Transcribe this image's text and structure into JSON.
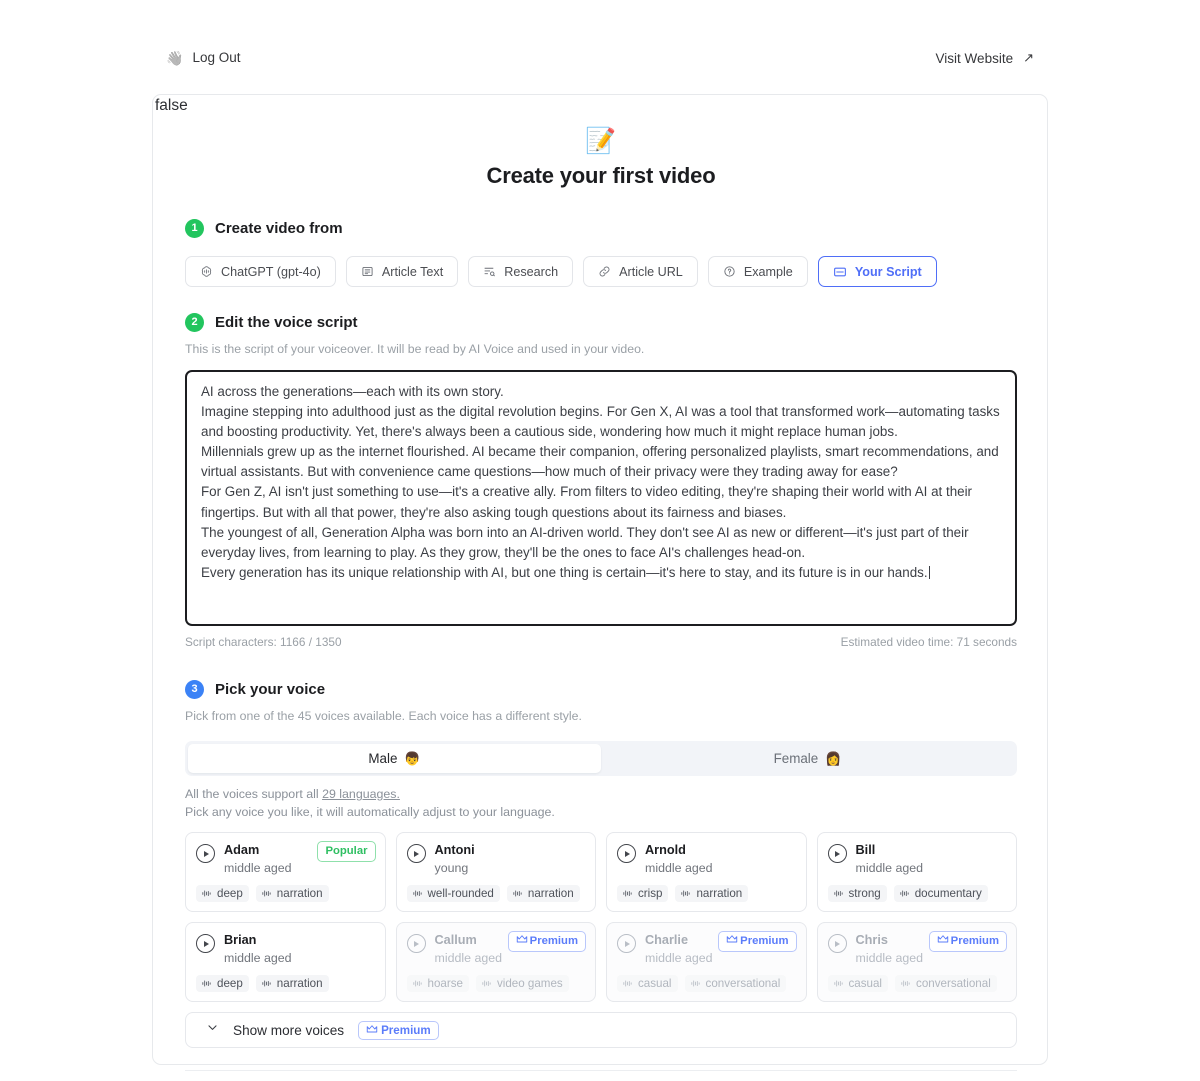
{
  "topbar": {
    "logout_label": "Log Out",
    "logout_icon": "waving-hand-icon",
    "visit_label": "Visit Website",
    "visit_icon": "external-link-arrow-icon"
  },
  "card": {
    "debug_text": "false"
  },
  "hero": {
    "icon": "memo-pencil-icon",
    "title": "Create your first video"
  },
  "step1": {
    "number": "1",
    "title": "Create video from",
    "options": [
      {
        "label": "ChatGPT (gpt-4o)",
        "icon": "openai-icon",
        "selected": false
      },
      {
        "label": "Article Text",
        "icon": "article-text-icon",
        "selected": false
      },
      {
        "label": "Research",
        "icon": "research-icon",
        "selected": false
      },
      {
        "label": "Article URL",
        "icon": "link-icon",
        "selected": false
      },
      {
        "label": "Example",
        "icon": "question-circle-icon",
        "selected": false
      },
      {
        "label": "Your Script",
        "icon": "script-icon",
        "selected": true
      }
    ]
  },
  "step2": {
    "number": "2",
    "title": "Edit the voice script",
    "hint": "This is the script of your voiceover. It will be read by AI Voice and used in your video.",
    "script": "AI across the generations—each with its own story.\nImagine stepping into adulthood just as the digital revolution begins. For Gen X, AI was a tool that transformed work—automating tasks and boosting productivity. Yet, there's always been a cautious side, wondering how much it might replace human jobs.\nMillennials grew up as the internet flourished. AI became their companion, offering personalized playlists, smart recommendations, and virtual assistants. But with convenience came questions—how much of their privacy were they trading away for ease?\nFor Gen Z, AI isn't just something to use—it's a creative ally. From filters to video editing, they're shaping their world with AI at their fingertips. But with all that power, they're also asking tough questions about its fairness and biases.\nThe youngest of all, Generation Alpha was born into an AI-driven world. They don't see AI as new or different—it's just part of their everyday lives, from learning to play. As they grow, they'll be the ones to face AI's challenges head-on.\nEvery generation has its unique relationship with AI, but one thing is certain—it's here to stay, and its future is in our hands.",
    "char_count": "Script characters: 1166 / 1350",
    "estimated_time": "Estimated video time: 71 seconds"
  },
  "step3": {
    "number": "3",
    "title": "Pick your voice",
    "hint": "Pick from one of the 45 voices available. Each voice has a different style.",
    "gender_tabs": [
      {
        "label": "Male",
        "emoji": "👦",
        "selected": true
      },
      {
        "label": "Female",
        "emoji": "👩",
        "selected": false
      }
    ],
    "lang_prefix": "All the voices support all ",
    "lang_link": "29 languages.",
    "lang_note": "Pick any voice you like, it will automatically adjust to your language.",
    "voices": [
      {
        "name": "Adam",
        "age": "middle aged",
        "tags": [
          "deep",
          "narration"
        ],
        "badge": "Popular",
        "badge_type": "popular",
        "dim": false
      },
      {
        "name": "Antoni",
        "age": "young",
        "tags": [
          "well-rounded",
          "narration"
        ],
        "badge": "",
        "badge_type": "",
        "dim": false
      },
      {
        "name": "Arnold",
        "age": "middle aged",
        "tags": [
          "crisp",
          "narration"
        ],
        "badge": "",
        "badge_type": "",
        "dim": false
      },
      {
        "name": "Bill",
        "age": "middle aged",
        "tags": [
          "strong",
          "documentary"
        ],
        "badge": "",
        "badge_type": "",
        "dim": false
      },
      {
        "name": "Brian",
        "age": "middle aged",
        "tags": [
          "deep",
          "narration"
        ],
        "badge": "",
        "badge_type": "",
        "dim": false
      },
      {
        "name": "Callum",
        "age": "middle aged",
        "tags": [
          "hoarse",
          "video games"
        ],
        "badge": "Premium",
        "badge_type": "premium",
        "dim": true
      },
      {
        "name": "Charlie",
        "age": "middle aged",
        "tags": [
          "casual",
          "conversational"
        ],
        "badge": "Premium",
        "badge_type": "premium",
        "dim": true
      },
      {
        "name": "Chris",
        "age": "middle aged",
        "tags": [
          "casual",
          "conversational"
        ],
        "badge": "Premium",
        "badge_type": "premium",
        "dim": true
      }
    ],
    "show_more_label": "Show more voices",
    "show_more_badge": "Premium",
    "show_more_icon": "chevron-down-icon",
    "crown_icon": "crown-icon"
  },
  "colors": {
    "green": "#22c55e",
    "blue": "#3b82f6",
    "accent_blue": "#4f6ef7",
    "premium_blue": "#5b7cfa",
    "popular_green": "#2fbf62"
  }
}
